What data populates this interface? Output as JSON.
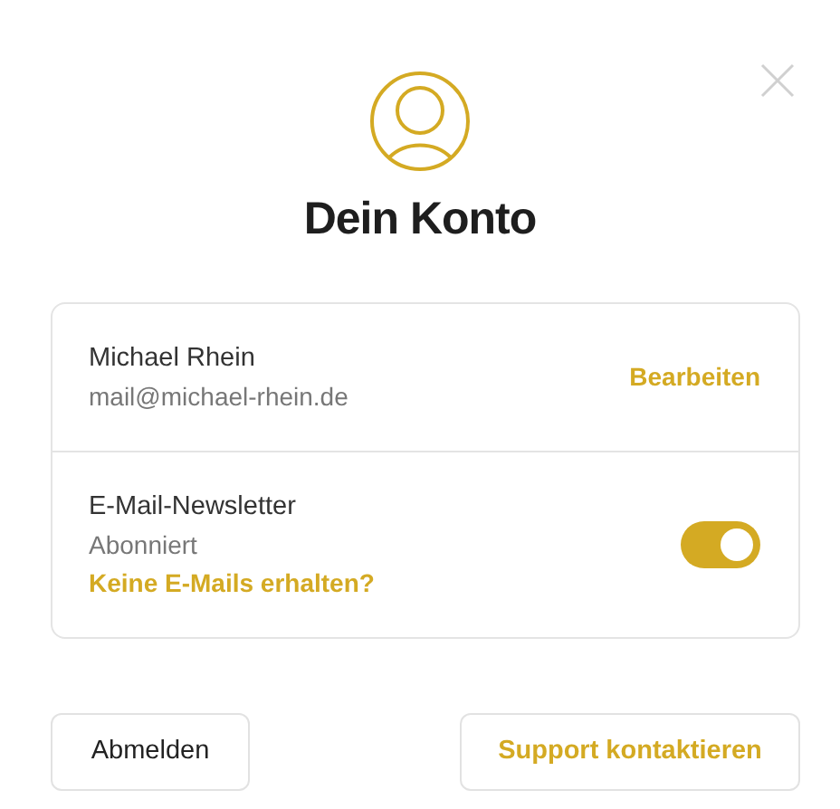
{
  "title": "Dein Konto",
  "account": {
    "name": "Michael Rhein",
    "email": "mail@michael-rhein.de",
    "edit_link": "Bearbeiten"
  },
  "newsletter": {
    "title": "E-Mail-Newsletter",
    "status": "Abonniert",
    "link": "Keine E-Mails erhalten?",
    "on": true
  },
  "buttons": [
    {
      "label": "Abmelden",
      "kind": "plain"
    },
    {
      "label": "Support kontaktieren",
      "kind": "accent"
    }
  ]
}
